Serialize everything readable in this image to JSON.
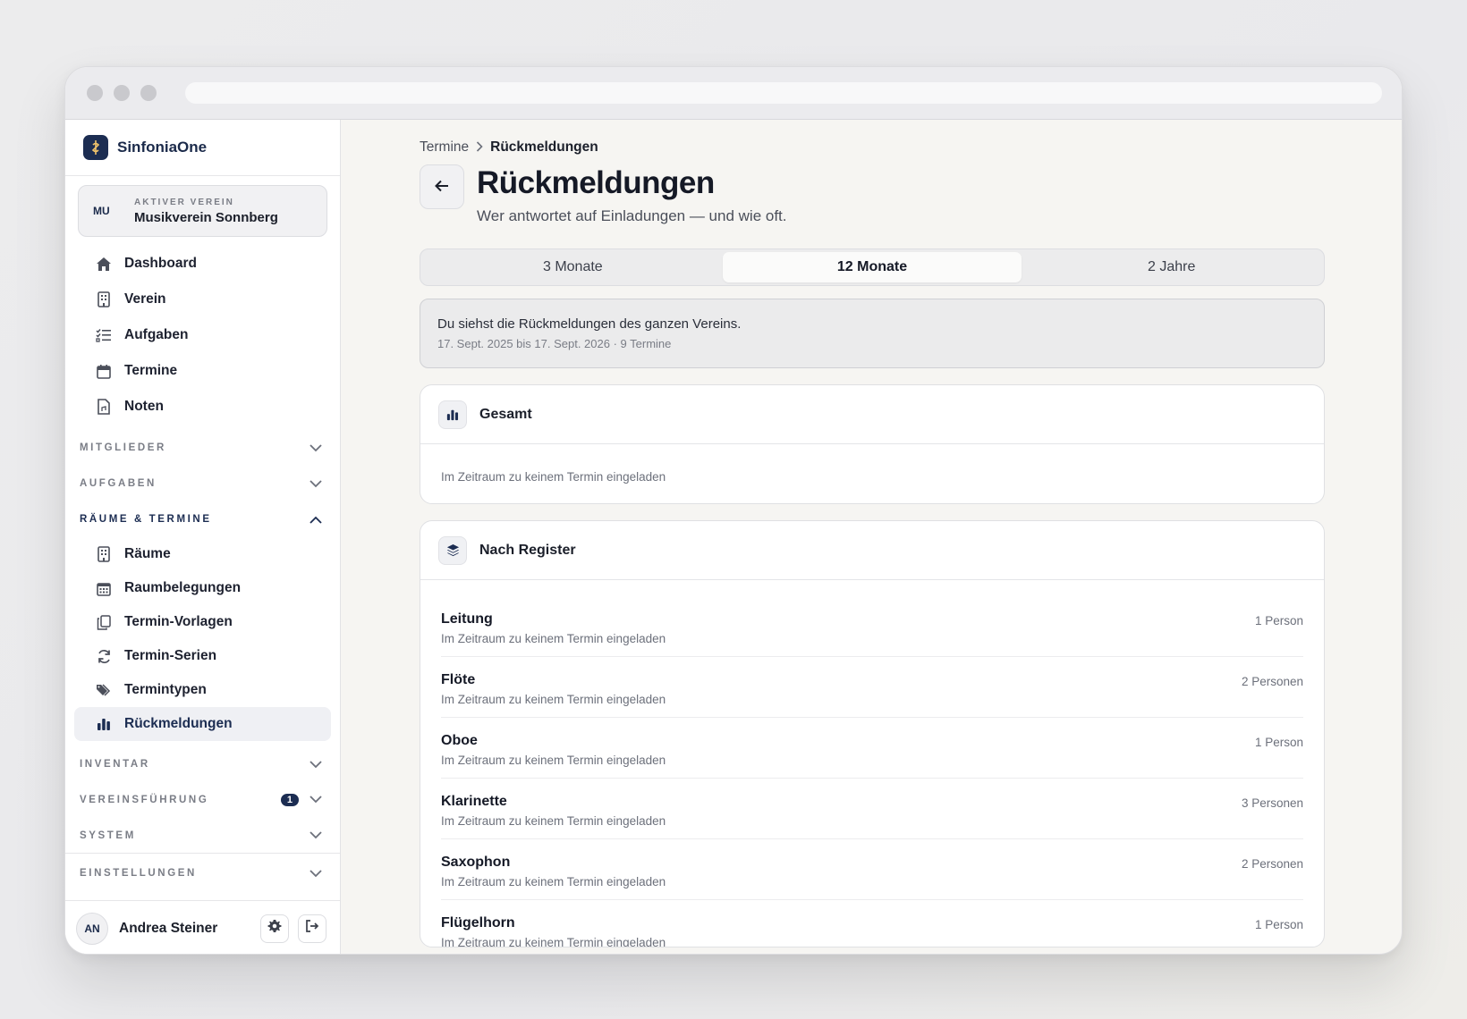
{
  "brand": {
    "name": "SinfoniaOne"
  },
  "club": {
    "badge": "MU",
    "label": "AKTIVER VEREIN",
    "name": "Musikverein Sonnberg"
  },
  "nav_top": [
    {
      "label": "Dashboard",
      "icon": "home-icon"
    },
    {
      "label": "Verein",
      "icon": "building-icon"
    },
    {
      "label": "Aufgaben",
      "icon": "checklist-icon"
    },
    {
      "label": "Termine",
      "icon": "calendar-icon"
    },
    {
      "label": "Noten",
      "icon": "document-icon"
    }
  ],
  "sections": {
    "mitglieder": "MITGLIEDER",
    "aufgaben": "AUFGABEN",
    "raeume": "RÄUME & TERMINE",
    "inventar": "INVENTAR",
    "vereinsfuehrung": "VEREINSFÜHRUNG",
    "vereinsfuehrung_badge": "1",
    "system": "SYSTEM",
    "einstellungen": "EINSTELLUNGEN"
  },
  "nav_raeume": [
    {
      "label": "Räume",
      "icon": "building-icon"
    },
    {
      "label": "Raumbelegungen",
      "icon": "calendar-grid-icon"
    },
    {
      "label": "Termin-Vorlagen",
      "icon": "copy-icon"
    },
    {
      "label": "Termin-Serien",
      "icon": "refresh-icon"
    },
    {
      "label": "Termintypen",
      "icon": "tags-icon"
    },
    {
      "label": "Rückmeldungen",
      "icon": "bar-chart-icon",
      "active": true
    }
  ],
  "user": {
    "initials": "AN",
    "name": "Andrea Steiner"
  },
  "breadcrumb": {
    "parent": "Termine",
    "current": "Rückmeldungen"
  },
  "page": {
    "title": "Rückmeldungen",
    "subtitle": "Wer antwortet auf Einladungen — und wie oft."
  },
  "range_tabs": [
    {
      "label": "3 Monate"
    },
    {
      "label": "12 Monate",
      "active": true
    },
    {
      "label": "2 Jahre"
    }
  ],
  "notice": {
    "line1": "Du siehst die Rückmeldungen des ganzen Vereins.",
    "line2": "17. Sept. 2025 bis 17. Sept. 2026 · 9 Termine"
  },
  "gesamt": {
    "title": "Gesamt",
    "empty": "Im Zeitraum zu keinem Termin eingeladen"
  },
  "register": {
    "title": "Nach Register",
    "rows": [
      {
        "name": "Leitung",
        "sub": "Im Zeitraum zu keinem Termin eingeladen",
        "count": "1 Person"
      },
      {
        "name": "Flöte",
        "sub": "Im Zeitraum zu keinem Termin eingeladen",
        "count": "2 Personen"
      },
      {
        "name": "Oboe",
        "sub": "Im Zeitraum zu keinem Termin eingeladen",
        "count": "1 Person"
      },
      {
        "name": "Klarinette",
        "sub": "Im Zeitraum zu keinem Termin eingeladen",
        "count": "3 Personen"
      },
      {
        "name": "Saxophon",
        "sub": "Im Zeitraum zu keinem Termin eingeladen",
        "count": "2 Personen"
      },
      {
        "name": "Flügelhorn",
        "sub": "Im Zeitraum zu keinem Termin eingeladen",
        "count": "1 Person"
      }
    ]
  },
  "colors": {
    "accent": "#1c2d52",
    "background": "#f6f5f2"
  }
}
